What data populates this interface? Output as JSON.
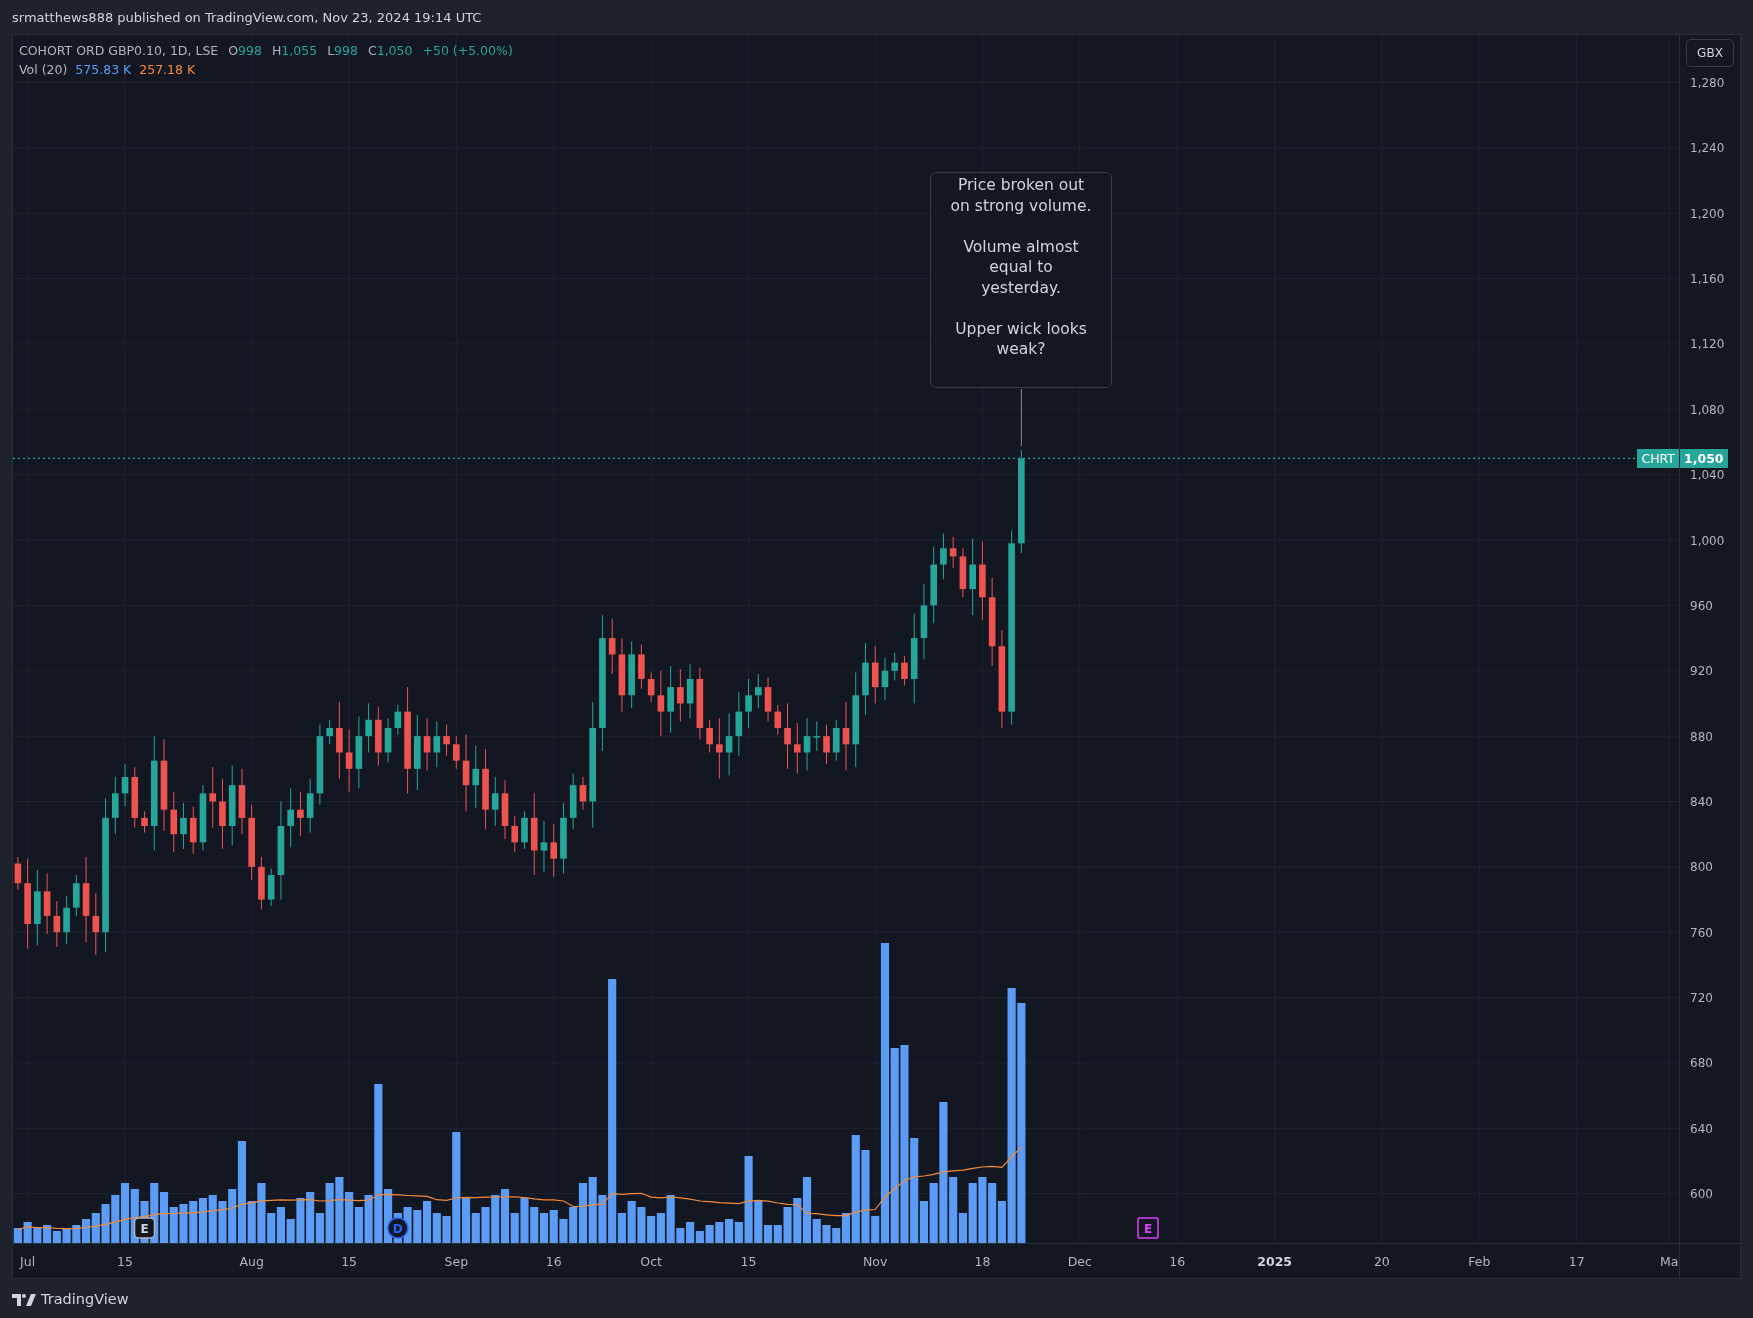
{
  "header": {
    "text": "srmatthews888 published on TradingView.com, Nov 23, 2024 19:14 UTC"
  },
  "legend": {
    "symbol": "COHORT ORD GBP0.10, 1D, LSE",
    "ohlc": [
      {
        "label": "O",
        "value": "998"
      },
      {
        "label": "H",
        "value": "1,055"
      },
      {
        "label": "L",
        "value": "998"
      },
      {
        "label": "C",
        "value": "1,050"
      }
    ],
    "change": "+50 (+5.00%)",
    "volume_label": "Vol (20)",
    "volume_values": [
      {
        "text": "575.83 K",
        "color": "#5b9cf6"
      },
      {
        "text": "257.18 K",
        "color": "#f68a3a"
      }
    ]
  },
  "currency_button": "GBX",
  "last_price": {
    "symbol": "CHRT",
    "price": "1,050"
  },
  "callout": "Price broken out\non strong volume.\n\nVolume almost\nequal to\nyesterday.\n\nUpper wick looks\nweak?",
  "markers": [
    {
      "label": "E",
      "kind": "earnings"
    },
    {
      "label": "D",
      "kind": "dividend"
    },
    {
      "label": "E",
      "kind": "upcoming-earnings"
    }
  ],
  "price_axis": {
    "labels": [
      "1,280",
      "1,240",
      "1,200",
      "1,160",
      "1,120",
      "1,080",
      "1,040",
      "1,000",
      "960",
      "920",
      "880",
      "840",
      "800",
      "760",
      "720",
      "680",
      "640",
      "600"
    ]
  },
  "time_axis": {
    "labels": [
      {
        "text": "Jul",
        "bold": false
      },
      {
        "text": "15",
        "bold": false
      },
      {
        "text": "Aug",
        "bold": false
      },
      {
        "text": "15",
        "bold": false
      },
      {
        "text": "Sep",
        "bold": false
      },
      {
        "text": "16",
        "bold": false
      },
      {
        "text": "Oct",
        "bold": false
      },
      {
        "text": "15",
        "bold": false
      },
      {
        "text": "Nov",
        "bold": false
      },
      {
        "text": "18",
        "bold": false
      },
      {
        "text": "Dec",
        "bold": false
      },
      {
        "text": "16",
        "bold": false
      },
      {
        "text": "2025",
        "bold": true
      },
      {
        "text": "20",
        "bold": false
      },
      {
        "text": "Feb",
        "bold": false
      },
      {
        "text": "17",
        "bold": false
      },
      {
        "text": "Ma",
        "bold": false
      }
    ]
  },
  "footer": {
    "brand": "TradingView"
  }
}
